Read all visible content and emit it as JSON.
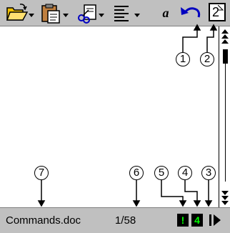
{
  "toolbar": {
    "buttons": [
      {
        "icon": "open-folder-icon"
      },
      {
        "icon": "paste-icon"
      },
      {
        "icon": "tools-icon"
      },
      {
        "icon": "align-icon"
      },
      {
        "icon": "italic-icon",
        "glyph": "a"
      },
      {
        "icon": "undo-icon"
      },
      {
        "icon": "page-view-icon",
        "glyph": "2"
      }
    ]
  },
  "callouts": [
    "1",
    "2",
    "3",
    "4",
    "5",
    "6",
    "7"
  ],
  "status": {
    "filename": "Commands.doc",
    "page": "1/58",
    "indicator_alert": "!",
    "indicator_count": "4"
  },
  "colors": {
    "chrome": "#c0c0c0",
    "indicator_bg": "#000000",
    "indicator_fg": "#00ff00",
    "folder": "#f0c000",
    "undo": "#0000c0"
  }
}
